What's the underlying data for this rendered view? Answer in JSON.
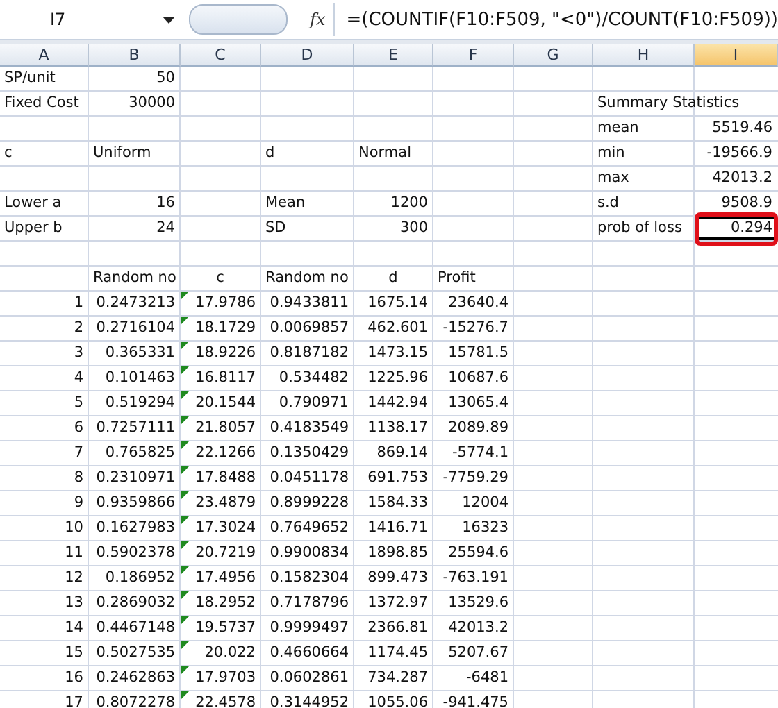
{
  "name_box": "I7",
  "fx_label": "fx",
  "formula": "=(COUNTIF(F10:F509, \"<0\")/COUNT(F10:F509))",
  "columns": [
    {
      "label": "A",
      "selected": false
    },
    {
      "label": "B",
      "selected": false
    },
    {
      "label": "C",
      "selected": false
    },
    {
      "label": "D",
      "selected": false
    },
    {
      "label": "E",
      "selected": false
    },
    {
      "label": "F",
      "selected": false
    },
    {
      "label": "G",
      "selected": false
    },
    {
      "label": "H",
      "selected": false
    },
    {
      "label": "I",
      "selected": true
    }
  ],
  "top_rows": [
    [
      {
        "text": "SP/unit",
        "kind": "text",
        "selected": false
      },
      {
        "text": "50",
        "kind": "number",
        "selected": false
      },
      null,
      null,
      null,
      null,
      null,
      null,
      null
    ],
    [
      {
        "text": "Fixed Cost",
        "kind": "text",
        "selected": false
      },
      {
        "text": "30000",
        "kind": "number",
        "selected": false
      },
      null,
      null,
      null,
      null,
      null,
      {
        "text": "Summary Statistics",
        "kind": "text",
        "selected": false
      },
      null
    ],
    [
      null,
      null,
      null,
      null,
      null,
      null,
      null,
      {
        "text": "mean",
        "kind": "text",
        "selected": false
      },
      {
        "text": "5519.46",
        "kind": "number",
        "selected": false
      }
    ],
    [
      {
        "text": "c",
        "kind": "text",
        "selected": false
      },
      {
        "text": "Uniform",
        "kind": "text",
        "selected": false
      },
      null,
      {
        "text": "d",
        "kind": "text",
        "selected": false
      },
      {
        "text": "Normal",
        "kind": "text",
        "selected": false
      },
      null,
      null,
      {
        "text": "min",
        "kind": "text",
        "selected": false
      },
      {
        "text": "-19566.9",
        "kind": "number",
        "selected": false
      }
    ],
    [
      null,
      null,
      null,
      null,
      null,
      null,
      null,
      {
        "text": "max",
        "kind": "text",
        "selected": false
      },
      {
        "text": "42013.2",
        "kind": "number",
        "selected": false
      }
    ],
    [
      {
        "text": "Lower a",
        "kind": "text",
        "selected": false
      },
      {
        "text": "16",
        "kind": "number",
        "selected": false
      },
      null,
      {
        "text": "Mean",
        "kind": "text",
        "selected": false
      },
      {
        "text": "1200",
        "kind": "number",
        "selected": false
      },
      null,
      null,
      {
        "text": "s.d",
        "kind": "text",
        "selected": false
      },
      {
        "text": "9508.9",
        "kind": "number",
        "selected": false
      }
    ],
    [
      {
        "text": "Upper b",
        "kind": "text",
        "selected": false
      },
      {
        "text": "24",
        "kind": "number",
        "selected": false
      },
      null,
      {
        "text": "SD",
        "kind": "text",
        "selected": false
      },
      {
        "text": "300",
        "kind": "number",
        "selected": false
      },
      null,
      null,
      {
        "text": "prob of loss",
        "kind": "text",
        "selected": false
      },
      {
        "text": "0.294",
        "kind": "number",
        "selected": true
      }
    ],
    [
      null,
      null,
      null,
      null,
      null,
      null,
      null,
      null,
      null
    ],
    [
      null,
      {
        "text": "Random no",
        "kind": "text",
        "selected": false
      },
      {
        "text": "c",
        "kind": "center",
        "selected": false
      },
      {
        "text": "Random no",
        "kind": "text",
        "selected": false
      },
      {
        "text": "d",
        "kind": "center",
        "selected": false
      },
      {
        "text": "Profit",
        "kind": "text",
        "selected": false
      },
      null,
      null,
      null
    ]
  ],
  "samples": [
    {
      "n": "1",
      "rand_c": "0.2473213",
      "c": "17.9786",
      "rand_d": "0.9433811",
      "d": "1675.14",
      "profit": "23640.4",
      "warning": true
    },
    {
      "n": "2",
      "rand_c": "0.2716104",
      "c": "18.1729",
      "rand_d": "0.0069857",
      "d": "462.601",
      "profit": "-15276.7",
      "warning": true
    },
    {
      "n": "3",
      "rand_c": "0.365331",
      "c": "18.9226",
      "rand_d": "0.8187182",
      "d": "1473.15",
      "profit": "15781.5",
      "warning": true
    },
    {
      "n": "4",
      "rand_c": "0.101463",
      "c": "16.8117",
      "rand_d": "0.534482",
      "d": "1225.96",
      "profit": "10687.6",
      "warning": true
    },
    {
      "n": "5",
      "rand_c": "0.519294",
      "c": "20.1544",
      "rand_d": "0.790971",
      "d": "1442.94",
      "profit": "13065.4",
      "warning": true
    },
    {
      "n": "6",
      "rand_c": "0.7257111",
      "c": "21.8057",
      "rand_d": "0.4183549",
      "d": "1138.17",
      "profit": "2089.89",
      "warning": true
    },
    {
      "n": "7",
      "rand_c": "0.765825",
      "c": "22.1266",
      "rand_d": "0.1350429",
      "d": "869.14",
      "profit": "-5774.1",
      "warning": true
    },
    {
      "n": "8",
      "rand_c": "0.2310971",
      "c": "17.8488",
      "rand_d": "0.0451178",
      "d": "691.753",
      "profit": "-7759.29",
      "warning": true
    },
    {
      "n": "9",
      "rand_c": "0.9359866",
      "c": "23.4879",
      "rand_d": "0.8999228",
      "d": "1584.33",
      "profit": "12004",
      "warning": true
    },
    {
      "n": "10",
      "rand_c": "0.1627983",
      "c": "17.3024",
      "rand_d": "0.7649652",
      "d": "1416.71",
      "profit": "16323",
      "warning": true
    },
    {
      "n": "11",
      "rand_c": "0.5902378",
      "c": "20.7219",
      "rand_d": "0.9900834",
      "d": "1898.85",
      "profit": "25594.6",
      "warning": true
    },
    {
      "n": "12",
      "rand_c": "0.186952",
      "c": "17.4956",
      "rand_d": "0.1582304",
      "d": "899.473",
      "profit": "-763.191",
      "warning": true
    },
    {
      "n": "13",
      "rand_c": "0.2869032",
      "c": "18.2952",
      "rand_d": "0.7178796",
      "d": "1372.97",
      "profit": "13529.6",
      "warning": true
    },
    {
      "n": "14",
      "rand_c": "0.4467148",
      "c": "19.5737",
      "rand_d": "0.9999497",
      "d": "2366.81",
      "profit": "42013.2",
      "warning": true
    },
    {
      "n": "15",
      "rand_c": "0.5027535",
      "c": "20.022",
      "rand_d": "0.4660664",
      "d": "1174.45",
      "profit": "5207.67",
      "warning": true
    },
    {
      "n": "16",
      "rand_c": "0.2462863",
      "c": "17.9703",
      "rand_d": "0.0602861",
      "d": "734.287",
      "profit": "-6481",
      "warning": true
    },
    {
      "n": "17",
      "rand_c": "0.8072278",
      "c": "22.4578",
      "rand_d": "0.3144952",
      "d": "1055.06",
      "profit": "-941.475",
      "warning": true
    }
  ]
}
